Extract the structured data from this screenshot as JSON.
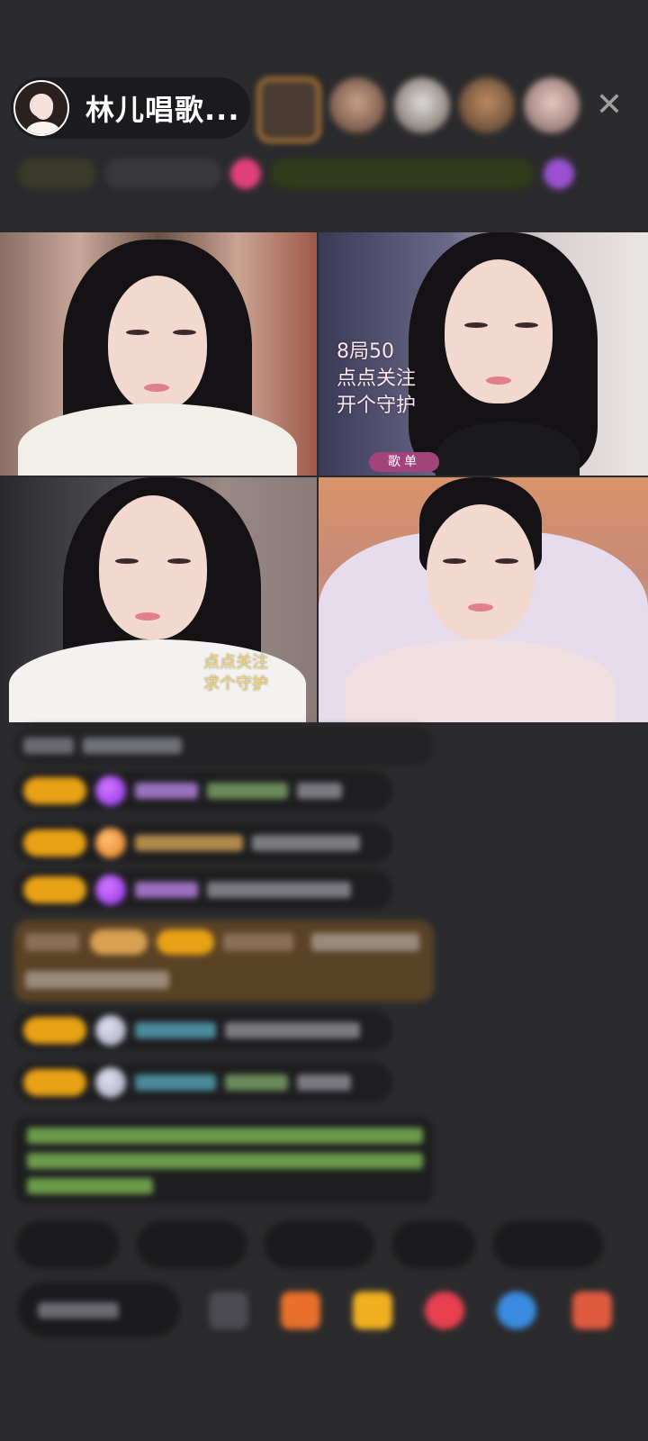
{
  "header": {
    "host_name": "林儿唱歌...",
    "close_glyph": "✕"
  },
  "video_tiles": [
    {
      "id": "tile-1"
    },
    {
      "id": "tile-2",
      "overlay_lines": [
        "8局50",
        "点点关注",
        "开个守护"
      ],
      "pill_label": "歌单"
    },
    {
      "id": "tile-3",
      "overlay_lines": [
        "点点关注",
        "求个守护"
      ]
    },
    {
      "id": "tile-4"
    }
  ],
  "colors": {
    "background": "#2b2b2d",
    "level_badge": "#e8a115",
    "song_pill": "#a2437c",
    "overlay_text_pink": "#ffe6ec",
    "overlay_text_gold": "#f5d36a"
  },
  "icons": {
    "close": "close-icon",
    "emoji": "emoji-icon",
    "gift": "gift-icon",
    "red_packet": "red-packet-icon",
    "game": "game-icon",
    "chat_bubble": "chat-bubble-icon",
    "more": "more-icon"
  }
}
